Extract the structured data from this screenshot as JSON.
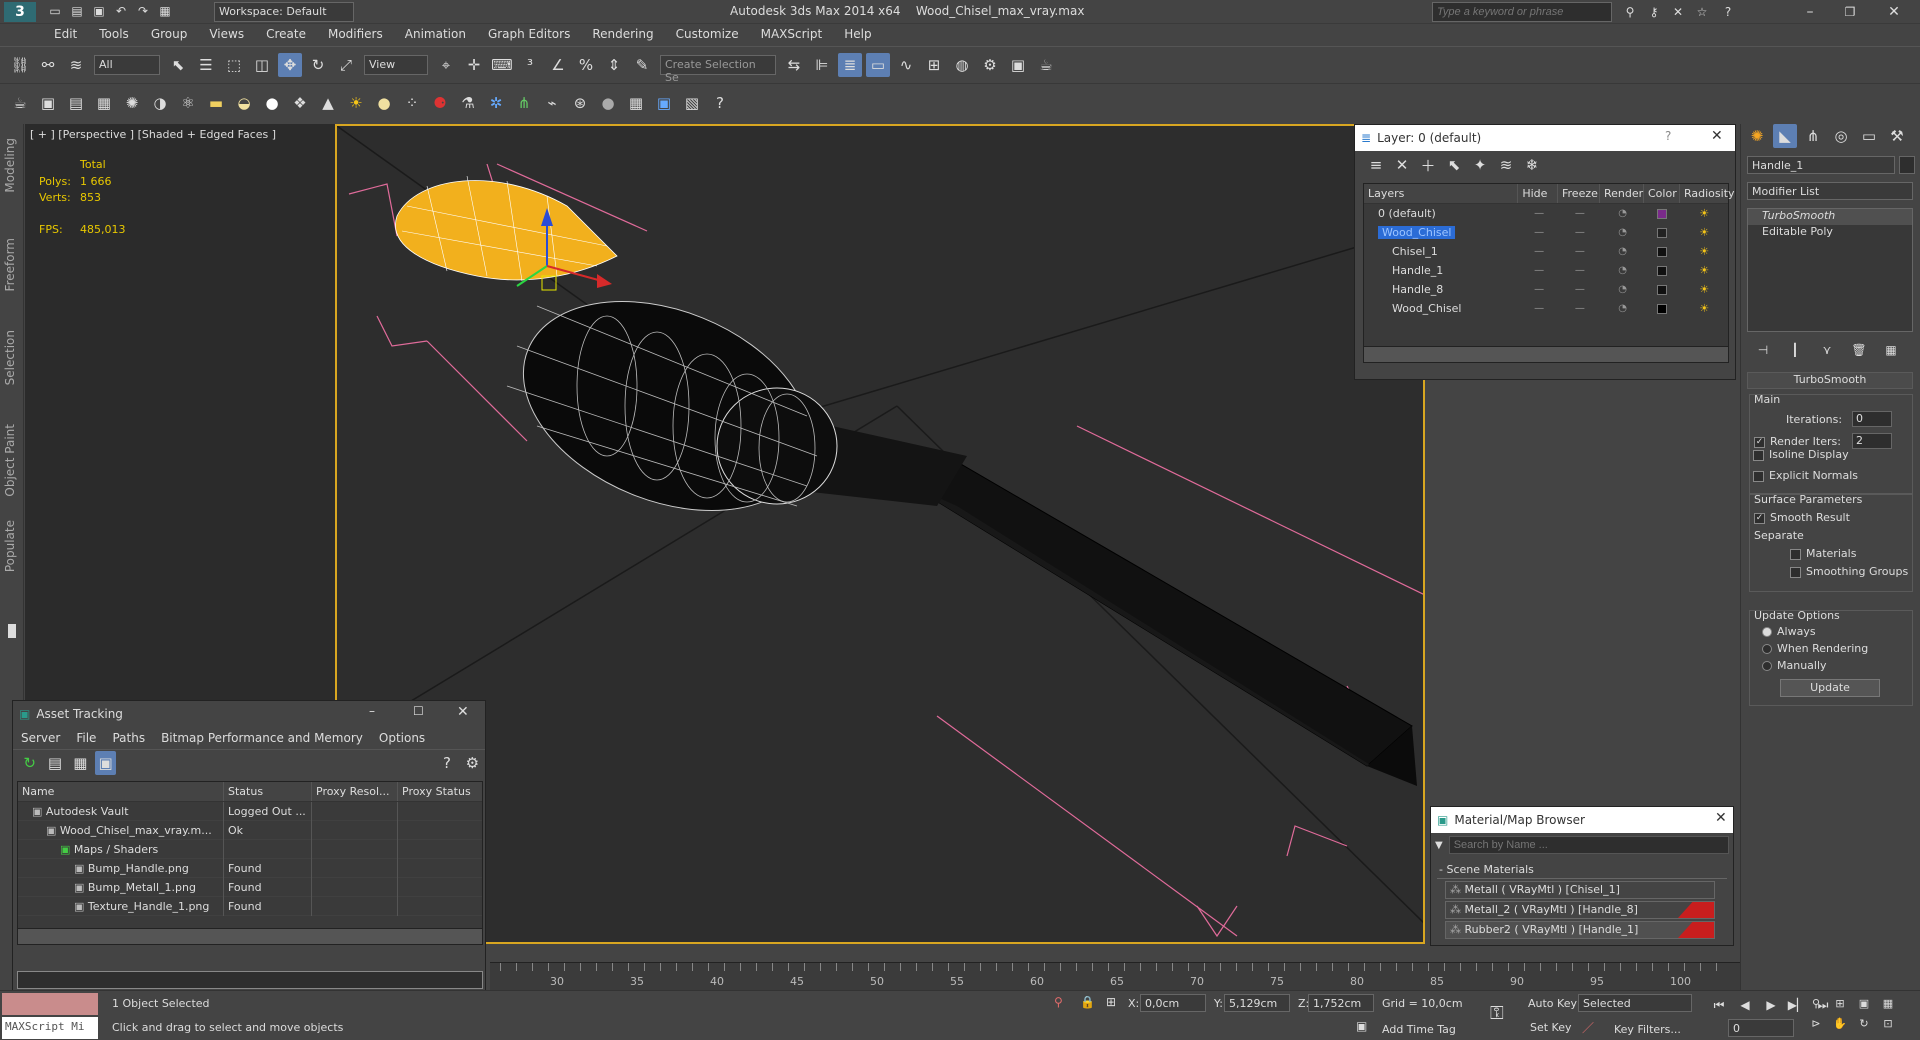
{
  "app": {
    "title": "Autodesk 3ds Max  2014 x64",
    "file": "Wood_Chisel_max_vray.max",
    "workspace": "Workspace: Default",
    "search_placeholder": "Type a keyword or phrase"
  },
  "menu": [
    "Edit",
    "Tools",
    "Group",
    "Views",
    "Create",
    "Modifiers",
    "Animation",
    "Graph Editors",
    "Rendering",
    "Customize",
    "MAXScript",
    "Help"
  ],
  "toolbar": {
    "filter": "All",
    "ref_coord": "View",
    "selection_set": "Create Selection Se"
  },
  "ribbon_tabs": [
    "Modeling",
    "Freeform",
    "Selection",
    "Object Paint",
    "Populate"
  ],
  "viewport": {
    "label": "[ + ] [Perspective ] [Shaded + Edged Faces ]",
    "stats_total": "Total",
    "polys_label": "Polys:",
    "polys_value": "1 666",
    "verts_label": "Verts:",
    "verts_value": "853",
    "fps_label": "FPS:",
    "fps_value": "485,013"
  },
  "layer_window": {
    "title": "Layer: 0 (default)",
    "columns": [
      "Layers",
      "Hide",
      "Freeze",
      "Render",
      "Color",
      "Radiosity"
    ],
    "rows": [
      {
        "name": "0 (default)",
        "color": "#7a2a8a",
        "indent": 1,
        "selected": false
      },
      {
        "name": "Wood_Chisel",
        "color": "#222222",
        "indent": 1,
        "selected": true
      },
      {
        "name": "Chisel_1",
        "color": "#111111",
        "indent": 2,
        "selected": false
      },
      {
        "name": "Handle_1",
        "color": "#111111",
        "indent": 2,
        "selected": false
      },
      {
        "name": "Handle_8",
        "color": "#111111",
        "indent": 2,
        "selected": false
      },
      {
        "name": "Wood_Chisel",
        "color": "#000000",
        "indent": 2,
        "selected": false
      }
    ]
  },
  "asset_window": {
    "title": "Asset Tracking",
    "menu": [
      "Server",
      "File",
      "Paths",
      "Bitmap Performance and Memory",
      "Options"
    ],
    "columns": [
      "Name",
      "Status",
      "Proxy Resol...",
      "Proxy Status"
    ],
    "rows": [
      {
        "name": "Autodesk Vault",
        "status": "Logged Out ...",
        "indent": 1
      },
      {
        "name": "Wood_Chisel_max_vray.m...",
        "status": "Ok",
        "indent": 2
      },
      {
        "name": "Maps / Shaders",
        "status": "",
        "indent": 3
      },
      {
        "name": "Bump_Handle.png",
        "status": "Found",
        "indent": 4
      },
      {
        "name": "Bump_Metall_1.png",
        "status": "Found",
        "indent": 4
      },
      {
        "name": "Texture_Handle_1.png",
        "status": "Found",
        "indent": 4
      }
    ]
  },
  "material_browser": {
    "title": "Material/Map Browser",
    "search_placeholder": "Search by Name ...",
    "section": "- Scene Materials",
    "items": [
      {
        "label": "Metall  ( VRayMtl ) [Chisel_1]",
        "red": false
      },
      {
        "label": "Metall_2  ( VRayMtl ) [Handle_8]",
        "red": true
      },
      {
        "label": "Rubber2  ( VRayMtl ) [Handle_1]",
        "red": true
      }
    ]
  },
  "command_panel": {
    "object_name": "Handle_1",
    "modifier_list": "Modifier List",
    "stack": [
      "TurboSmooth",
      "Editable Poly"
    ],
    "rollout_title": "TurboSmooth",
    "main": "Main",
    "iterations_label": "Iterations:",
    "iterations_value": "0",
    "render_iters_label": "Render Iters:",
    "render_iters_value": "2",
    "isoline": "Isoline Display",
    "explicit_normals": "Explicit Normals",
    "surface_params": "Surface Parameters",
    "smooth_result": "Smooth Result",
    "separate": "Separate",
    "materials": "Materials",
    "smoothing_groups": "Smoothing Groups",
    "update_options": "Update Options",
    "always": "Always",
    "when_rendering": "When Rendering",
    "manually": "Manually",
    "update_btn": "Update"
  },
  "timeline": {
    "labels": [
      "30",
      "35",
      "40",
      "45",
      "50",
      "55",
      "60",
      "65",
      "70",
      "75",
      "80",
      "85",
      "90",
      "95",
      "100"
    ]
  },
  "status": {
    "maxscript": "MAXScript Mi",
    "selected": "1 Object Selected",
    "prompt": "Click and drag to select and move objects",
    "x_label": "X:",
    "x_value": "0,0cm",
    "y_label": "Y:",
    "y_value": "5,129cm",
    "z_label": "Z:",
    "z_value": "1,752cm",
    "grid": "Grid = 10,0cm",
    "add_time_tag": "Add Time Tag",
    "auto_key": "Auto Key",
    "set_key": "Set Key",
    "selected_dd": "Selected",
    "key_filters": "Key Filters...",
    "frame": "0"
  }
}
